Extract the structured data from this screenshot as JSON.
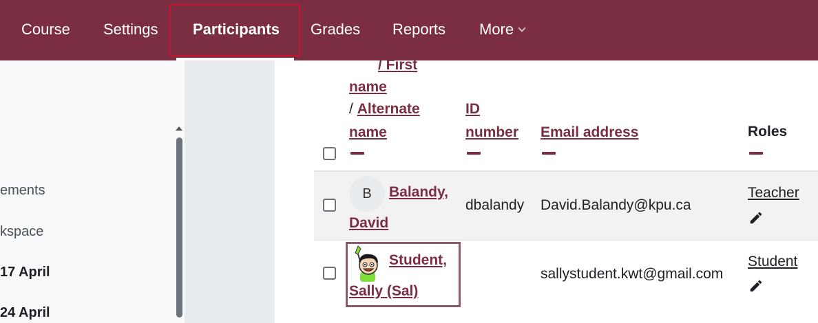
{
  "nav": {
    "course": "Course",
    "settings": "Settings",
    "participants": "Participants",
    "grades": "Grades",
    "reports": "Reports",
    "more": "More"
  },
  "drawer": {
    "items": [
      "ements",
      "kspace",
      "17 April",
      "24 April"
    ]
  },
  "table": {
    "header": {
      "name_partial_top": "/ First",
      "name_partial_bottom": "name",
      "alternate": "Alternate",
      "alternate_name": "name",
      "slash": "/",
      "id_1": "ID",
      "id_2": "number",
      "email": "Email address",
      "roles": "Roles"
    },
    "rows": [
      {
        "avatar": "B",
        "name_1": "Balandy,",
        "name_2": "David",
        "id": "dbalandy",
        "email": "David.Balandy@kpu.ca",
        "role": "Teacher"
      },
      {
        "name_1": "Student,",
        "name_2": "Sally (Sal)",
        "id": "",
        "email": "sallystudent.kwt@gmail.com",
        "role": "Student"
      }
    ]
  },
  "colors": {
    "brand": "#7b2d42",
    "active_outline": "#c4122f"
  }
}
